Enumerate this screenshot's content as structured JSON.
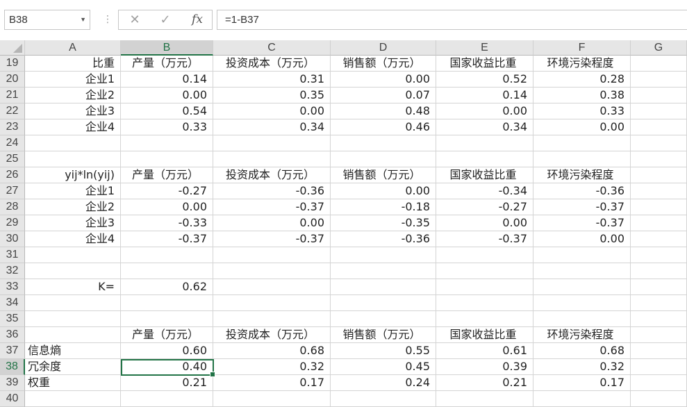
{
  "formula_bar": {
    "name_box": "B38",
    "cancel_icon": "✕",
    "enter_icon": "✓",
    "fx_label": "fx",
    "formula": "=1-B37"
  },
  "columns": [
    "A",
    "B",
    "C",
    "D",
    "E",
    "F",
    "G"
  ],
  "selected_column": "B",
  "selected_row": "38",
  "rows": [
    {
      "n": "19",
      "cells": [
        "比重",
        "产量（万元）",
        "投资成本（万元）",
        "销售额（万元）",
        "国家收益比重",
        "环境污染程度",
        ""
      ]
    },
    {
      "n": "20",
      "cells": [
        "企业1",
        "0.14",
        "0.31",
        "0.00",
        "0.52",
        "0.28",
        ""
      ]
    },
    {
      "n": "21",
      "cells": [
        "企业2",
        "0.00",
        "0.35",
        "0.07",
        "0.14",
        "0.38",
        ""
      ]
    },
    {
      "n": "22",
      "cells": [
        "企业3",
        "0.54",
        "0.00",
        "0.48",
        "0.00",
        "0.33",
        ""
      ]
    },
    {
      "n": "23",
      "cells": [
        "企业4",
        "0.33",
        "0.34",
        "0.46",
        "0.34",
        "0.00",
        ""
      ]
    },
    {
      "n": "24",
      "cells": [
        "",
        "",
        "",
        "",
        "",
        "",
        ""
      ]
    },
    {
      "n": "25",
      "cells": [
        "",
        "",
        "",
        "",
        "",
        "",
        ""
      ]
    },
    {
      "n": "26",
      "cells": [
        "yij*ln(yij)",
        "产量（万元）",
        "投资成本（万元）",
        "销售额（万元）",
        "国家收益比重",
        "环境污染程度",
        ""
      ]
    },
    {
      "n": "27",
      "cells": [
        "企业1",
        "-0.27",
        "-0.36",
        "0.00",
        "-0.34",
        "-0.36",
        ""
      ]
    },
    {
      "n": "28",
      "cells": [
        "企业2",
        "0.00",
        "-0.37",
        "-0.18",
        "-0.27",
        "-0.37",
        ""
      ]
    },
    {
      "n": "29",
      "cells": [
        "企业3",
        "-0.33",
        "0.00",
        "-0.35",
        "0.00",
        "-0.37",
        ""
      ]
    },
    {
      "n": "30",
      "cells": [
        "企业4",
        "-0.37",
        "-0.37",
        "-0.36",
        "-0.37",
        "0.00",
        ""
      ]
    },
    {
      "n": "31",
      "cells": [
        "",
        "",
        "",
        "",
        "",
        "",
        ""
      ]
    },
    {
      "n": "32",
      "cells": [
        "",
        "",
        "",
        "",
        "",
        "",
        ""
      ]
    },
    {
      "n": "33",
      "cells": [
        "K=",
        "0.62",
        "",
        "",
        "",
        "",
        ""
      ]
    },
    {
      "n": "34",
      "cells": [
        "",
        "",
        "",
        "",
        "",
        "",
        ""
      ]
    },
    {
      "n": "35",
      "cells": [
        "",
        "",
        "",
        "",
        "",
        "",
        ""
      ]
    },
    {
      "n": "36",
      "cells": [
        "",
        "产量（万元）",
        "投资成本（万元）",
        "销售额（万元）",
        "国家收益比重",
        "环境污染程度",
        ""
      ]
    },
    {
      "n": "37",
      "cells": [
        "信息熵",
        "0.60",
        "0.68",
        "0.55",
        "0.61",
        "0.68",
        ""
      ]
    },
    {
      "n": "38",
      "cells": [
        "冗余度",
        "0.40",
        "0.32",
        "0.45",
        "0.39",
        "0.32",
        ""
      ]
    },
    {
      "n": "39",
      "cells": [
        "权重",
        "0.21",
        "0.17",
        "0.24",
        "0.21",
        "0.17",
        ""
      ]
    },
    {
      "n": "40",
      "cells": [
        "",
        "",
        "",
        "",
        "",
        "",
        ""
      ]
    }
  ]
}
